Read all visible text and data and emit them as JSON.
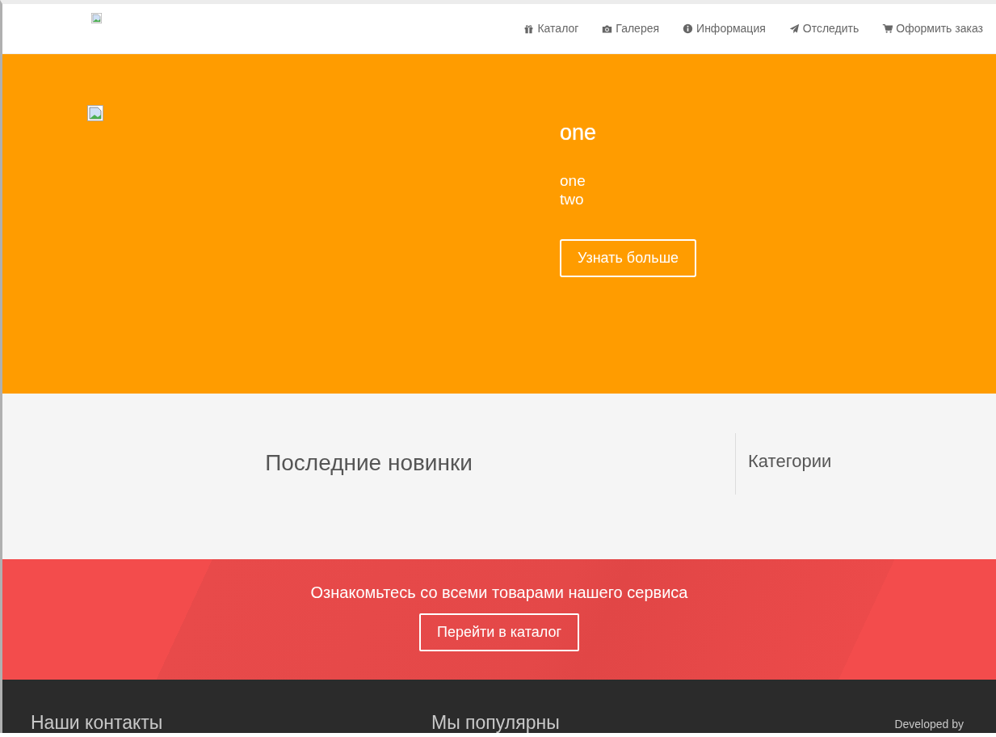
{
  "header": {
    "nav": [
      {
        "label": "Каталог",
        "kind": "gift"
      },
      {
        "label": "Галерея",
        "kind": "camera"
      },
      {
        "label": "Информация",
        "kind": "info"
      },
      {
        "label": "Отследить",
        "kind": "plane"
      },
      {
        "label": "Оформить заказ",
        "kind": "cart"
      }
    ]
  },
  "hero": {
    "title": "one",
    "lines": [
      "one",
      "two"
    ],
    "button": "Узнать больше"
  },
  "news": {
    "title": "Последние новинки",
    "sidebar_title": "Категории"
  },
  "cta": {
    "text": "Ознакомьтесь со всеми товарами нашего сервиса",
    "button": "Перейти в каталог"
  },
  "footer": {
    "contacts_title": "Наши контакты",
    "popular_title": "Мы популярны",
    "credit": "Developed by"
  }
}
